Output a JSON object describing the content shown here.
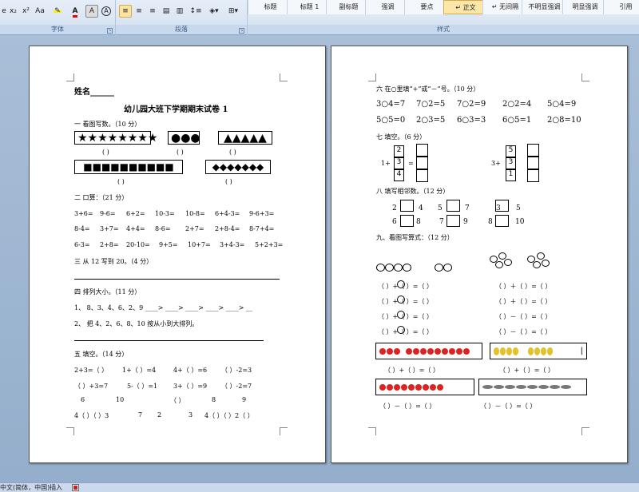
{
  "ribbon": {
    "font_group": {
      "label": "字体",
      "buttons": [
        "x₂",
        "x²",
        "Aa",
        "A",
        "A"
      ]
    },
    "paragraph_group": {
      "label": "段落"
    },
    "styles_group": {
      "label": "样式",
      "row1": [
        "标题",
        "标题 1",
        "副标题",
        "强调",
        "要点",
        "正文",
        "无间隔",
        "不明显强调",
        "明显强调",
        "引用"
      ],
      "active_index": 5,
      "active_marker": "↵",
      "nospacing_marker": "↵"
    }
  },
  "page1": {
    "name_label": "姓名______",
    "title": "幼儿园大班下学期期末试卷 1",
    "s1": {
      "heading": "一 看图写数。（10 分）",
      "row1_shapes": [
        "★★★★★★★★",
        "●●●",
        "▲▲▲▲▲"
      ],
      "blank": "(     )",
      "row2_shapes": [
        "■■■■■■■■■■",
        "◆◆◆◆◆◆◆"
      ]
    },
    "s2": {
      "heading": "二 口算：（21 分）",
      "rows": [
        [
          "3+6=",
          "9-6=",
          "6+2=",
          "10-3=",
          "10-8=",
          "6+4-3=",
          "9-6+3="
        ],
        [
          "8-4=",
          "3+7=",
          "4+4=",
          "8-6=",
          "2+7=",
          "2+8-4=",
          "8-7+4="
        ],
        [
          "6-3=",
          "2+8=",
          "20-10=",
          "9+5=",
          "10+7=",
          "3+4-3=",
          "5+2+3="
        ]
      ]
    },
    "s3": {
      "heading": "三   从 12 写到 20。（4 分）"
    },
    "s4": {
      "heading": "四   排列大小。（11 分）",
      "line1": "1、    8、3、4、6、2、9          ____> ____> ____> ____> ____> __",
      "line2": "2、    把 4、2、6、8、10 按从小到大排列。"
    },
    "s5": {
      "heading": "五   填空。（14 分）",
      "rows": [
        [
          "2+3=（   ）",
          "1+（   ）=4",
          "4+（   ）=6",
          "（   ）-2=3"
        ],
        [
          "（   ）+3=7",
          "5-（   ）=1",
          "3+（   ）=9",
          "（   ）-2=7"
        ],
        [
          "6",
          "10",
          "（   ）",
          "8",
          "9"
        ],
        [
          "4（  ）（  ）3",
          "7",
          "2",
          "3",
          "4（  ）（  ）2（  ）"
        ]
      ]
    }
  },
  "page2": {
    "s6": {
      "heading": "六   在○里填“+”或“－”号。（10 分）",
      "rows": [
        [
          "3○4=7",
          "7○2=5",
          "7○2=9",
          "2○2=4",
          "5○4=9"
        ],
        [
          "5○5=0",
          "2○3=5",
          "6○3=3",
          "6○5=1",
          "2○8=10"
        ]
      ]
    },
    "s7": {
      "heading": "七   填空。（6 分）",
      "left_prefix": "1+",
      "left_nums": [
        "2",
        "3",
        "4"
      ],
      "eq": "=",
      "right_prefix": "3+",
      "right_nums": [
        "5",
        "3",
        "1"
      ]
    },
    "s8": {
      "heading": "八 填写相邻数。（12 分）",
      "rows": [
        [
          "2",
          "4",
          "5",
          "7",
          "3",
          "5"
        ],
        [
          "6",
          "8",
          "7",
          "9",
          "8",
          "10"
        ]
      ]
    },
    "s9": {
      "heading": "九、看图写算式：（12 分）",
      "eq_plus": "（   ）+（   ）=（   ）",
      "eq_minus": "（   ）－（   ）=（   ）",
      "eq_plus_b": "（   ）＋（   ）=（   ）",
      "fruit_row1_end": "|"
    }
  },
  "statusbar": {
    "lang": "中文(简体，中国)",
    "mode": "插入"
  }
}
